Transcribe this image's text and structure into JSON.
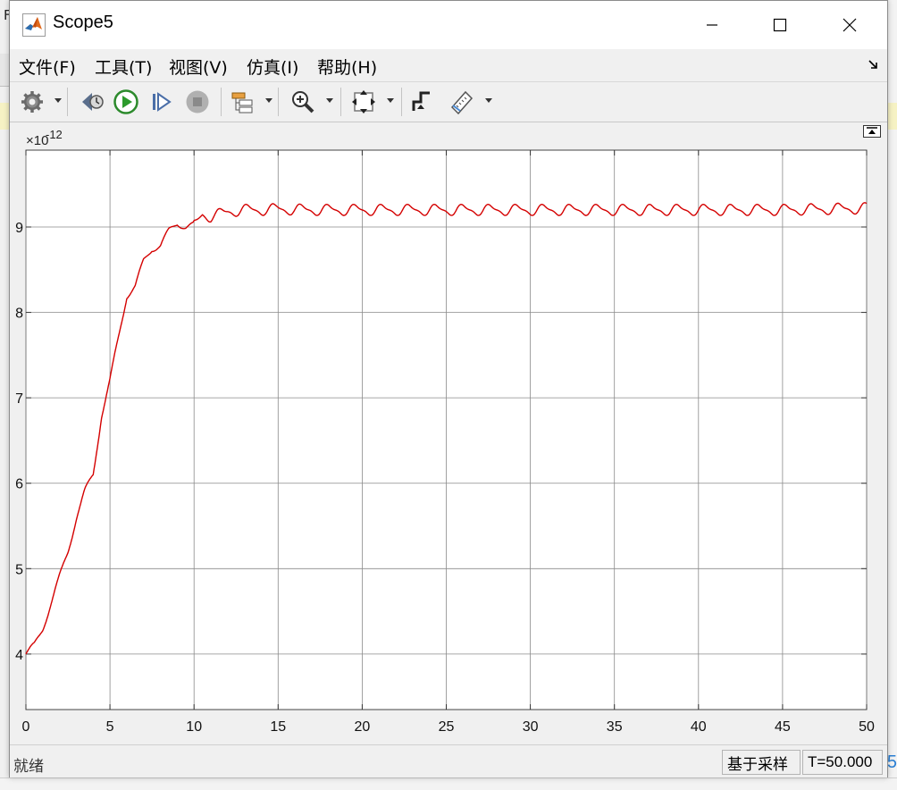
{
  "background": {
    "peek_left_text": "F",
    "peek_right_text": "5"
  },
  "window": {
    "title": "Scope5",
    "app_icon": "matlab-logo-icon",
    "controls": [
      "minimize-icon",
      "maximize-icon",
      "close-icon"
    ]
  },
  "menu": {
    "items": [
      "文件(F)",
      "工具(T)",
      "视图(V)",
      "仿真(I)",
      "帮助(H)"
    ],
    "undock_icon": "undock-arrow-icon"
  },
  "toolbar": {
    "buttons": [
      "settings-icon",
      "step-back-icon",
      "run-icon",
      "step-forward-icon",
      "stop-icon",
      "signal-hierarchy-icon",
      "zoom-in-icon",
      "fit-to-view-icon",
      "triggers-icon",
      "measurements-icon"
    ]
  },
  "plot": {
    "exponent_prefix": "×10",
    "exponent_power": "-12",
    "undock_icon": "undock-axes-icon"
  },
  "chart_data": {
    "type": "line",
    "title": "",
    "xlabel": "",
    "ylabel": "",
    "xlim": [
      0,
      50
    ],
    "ylim": [
      3.35,
      9.9
    ],
    "y_scale_exponent": -12,
    "x_ticks": [
      "0",
      "5",
      "10",
      "15",
      "20",
      "25",
      "30",
      "35",
      "40",
      "45",
      "50"
    ],
    "y_ticks": [
      "4",
      "5",
      "6",
      "7",
      "8",
      "9"
    ],
    "grid": true,
    "series": [
      {
        "color": "#d40000",
        "x": [
          0,
          0.5,
          1,
          1.5,
          2,
          2.5,
          3,
          3.5,
          4,
          4.5,
          5,
          5.5,
          6,
          6.5,
          7,
          7.5,
          8,
          8.5,
          9,
          9.5,
          10,
          10.5,
          11,
          12,
          13,
          14,
          15,
          17,
          20,
          25,
          30,
          35,
          40,
          45,
          50
        ],
        "y": [
          4.0,
          4.1,
          4.3,
          4.6,
          4.9,
          5.2,
          5.6,
          5.9,
          6.1,
          6.8,
          7.2,
          7.7,
          8.2,
          8.3,
          8.6,
          8.75,
          8.78,
          8.95,
          9.05,
          9.0,
          9.02,
          9.15,
          9.12,
          9.18,
          9.2,
          9.2,
          9.21,
          9.2,
          9.2,
          9.2,
          9.2,
          9.2,
          9.2,
          9.2,
          9.22
        ]
      }
    ]
  },
  "status": {
    "state": "就绪",
    "mode": "基于采样",
    "time": "T=50.000"
  }
}
